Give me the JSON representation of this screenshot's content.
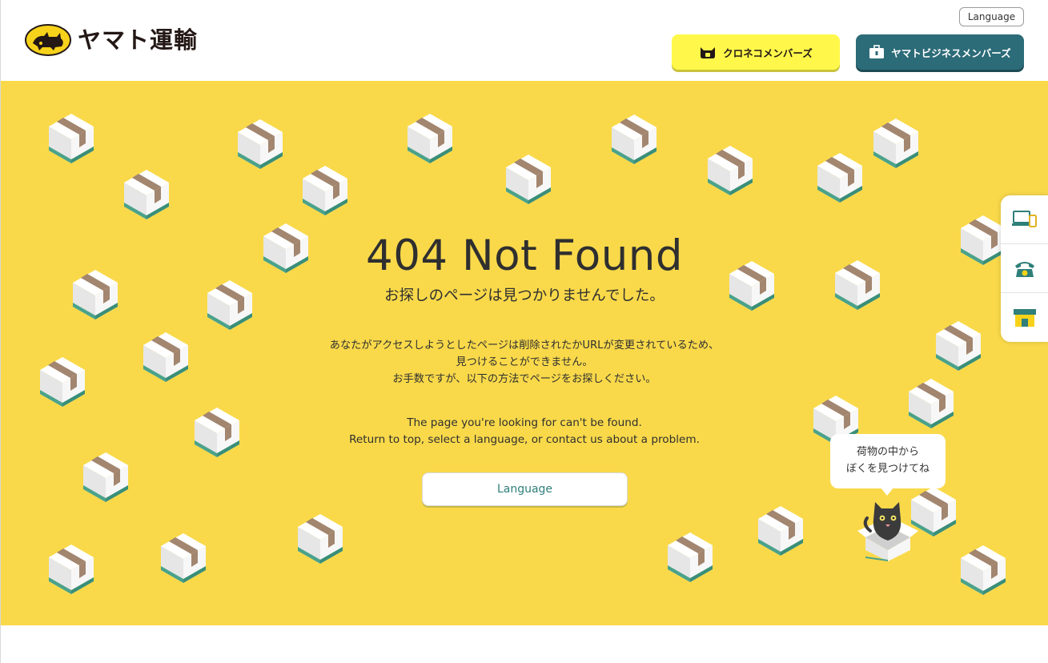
{
  "header": {
    "logo_text": "ヤマト運輸",
    "language_label": "Language",
    "kuroneko_members_label": "クロネコメンバーズ",
    "business_members_label": "ヤマトビジネスメンバーズ"
  },
  "main": {
    "title": "404 Not Found",
    "subtitle": "お探しのページは見つかりませんでした。",
    "description_jp": [
      "あなたがアクセスしようとしたページは削除されたかURLが変更されているため、",
      "見つけることができません。",
      "お手数ですが、以下の方法でページをお探しください。"
    ],
    "description_en": [
      "The page you're looking for can't be found.",
      "Return to top, select a language, or contact us about a problem."
    ],
    "language_button": "Language"
  },
  "cat_bubble": {
    "lines": [
      "荷物の中から",
      "ぼくを見つけてね"
    ]
  },
  "side_menu": {
    "items": [
      {
        "icon": "computer-mobile-icon"
      },
      {
        "icon": "telephone-icon"
      },
      {
        "icon": "store-icon"
      }
    ]
  },
  "colors": {
    "hero_background": "#f9d94a",
    "kuroneko_button": "#fff84a",
    "business_button": "#2c6b78",
    "accent_teal": "#2f7f7a"
  }
}
